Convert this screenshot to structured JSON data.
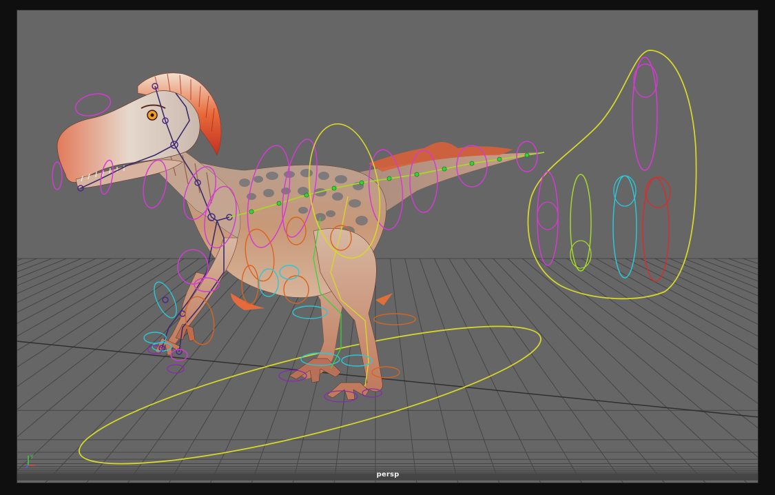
{
  "viewport": {
    "camera_label": "persp",
    "background": "#666666",
    "grid_color": "#3f3f3f"
  },
  "axis_gizmo": {
    "x_color": "#e04040",
    "y_color": "#40d040",
    "z_color": "#4060ff",
    "y_label": "y"
  },
  "rig": {
    "controller_colors": {
      "magenta": "#d23cd2",
      "yellow": "#d7d72a",
      "yellow_green": "#a6d82a",
      "cyan": "#2ac8d8",
      "red": "#d23030",
      "orange": "#d8641e",
      "green": "#3ad23a",
      "purple": "#5a2a9a"
    },
    "selector_panel": [
      "ik-fk-switch-left-arm",
      "ik-fk-switch-left-leg",
      "ik-fk-switch-spine",
      "ik-fk-switch-right-leg",
      "ik-fk-switch-right-arm"
    ]
  },
  "creature": {
    "skin_base": "#c89878",
    "crest": "#d8502a",
    "spots": "#6a6e76"
  }
}
